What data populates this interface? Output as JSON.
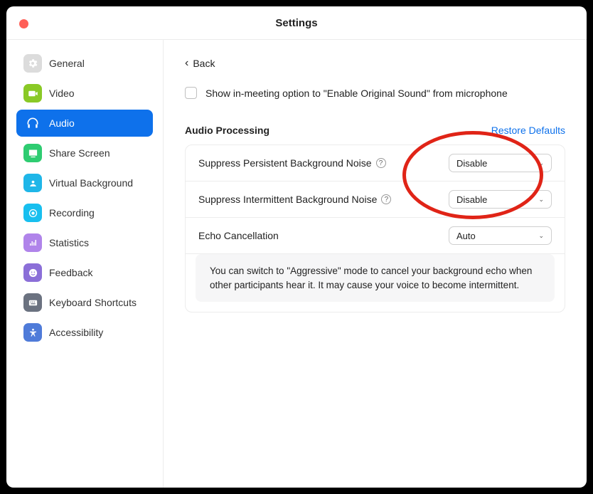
{
  "window": {
    "title": "Settings"
  },
  "sidebar": {
    "items": [
      {
        "label": "General"
      },
      {
        "label": "Video"
      },
      {
        "label": "Audio"
      },
      {
        "label": "Share Screen"
      },
      {
        "label": "Virtual Background"
      },
      {
        "label": "Recording"
      },
      {
        "label": "Statistics"
      },
      {
        "label": "Feedback"
      },
      {
        "label": "Keyboard Shortcuts"
      },
      {
        "label": "Accessibility"
      }
    ]
  },
  "main": {
    "back": "Back",
    "original_sound": "Show in-meeting option to \"Enable Original Sound\" from microphone",
    "section_title": "Audio Processing",
    "restore": "Restore Defaults",
    "rows": [
      {
        "label": "Suppress Persistent Background Noise",
        "value": "Disable"
      },
      {
        "label": "Suppress Intermittent Background Noise",
        "value": "Disable"
      },
      {
        "label": "Echo Cancellation",
        "value": "Auto"
      }
    ],
    "note": "You can switch to \"Aggressive\" mode to cancel your background echo when other participants hear it. It may cause your voice to become intermittent."
  }
}
